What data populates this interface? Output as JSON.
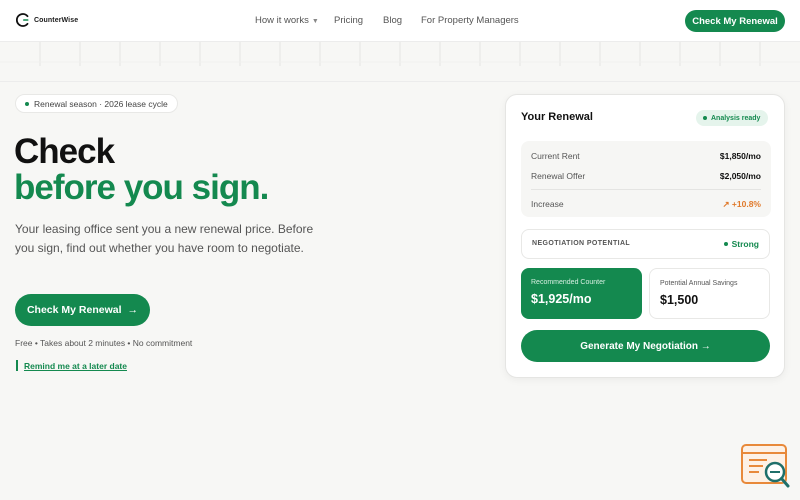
{
  "brand": {
    "name": "CounterWise"
  },
  "nav": {
    "items": [
      {
        "label": "How it works",
        "has_dropdown": true
      },
      {
        "label": "Pricing"
      },
      {
        "label": "Blog"
      },
      {
        "label": "For Property Managers"
      }
    ],
    "cta_label": "Check My Renewal"
  },
  "hero": {
    "pill_text": "Renewal season · 2026 lease cycle",
    "headline_line1": "Check",
    "headline_line2": "before you sign.",
    "subtext": "Your leasing office sent you a new renewal price. Before you sign, find out whether you have room to negotiate.",
    "cta_label": "Check My Renewal",
    "cta_arrow": "→",
    "meta": "Free • Takes about 2 minutes • No commitment",
    "remind_link": "Remind me at a later date"
  },
  "card": {
    "title": "Your Renewal",
    "badge": "Analysis ready",
    "rows": [
      {
        "label": "Current Rent",
        "value": "$1,850/mo"
      },
      {
        "label": "Renewal Offer",
        "value": "$2,050/mo"
      },
      {
        "label": "Increase",
        "value": "↗ +10.8%"
      }
    ],
    "potential_label": "NEGOTIATION POTENTIAL",
    "potential_value": "Strong",
    "counter_label": "Recommended Counter",
    "counter_value": "$1,925/mo",
    "savings_label": "Potential Annual Savings",
    "savings_value": "$1,500",
    "button_label": "Generate My Negotiation →"
  },
  "colors": {
    "accent": "#14894f",
    "increase": "#e07a2c",
    "background": "#f7f7f5",
    "widget": "#e8893a"
  },
  "icons": {
    "logo": "counterwise-logo-icon",
    "arrow": "arrow-right-icon",
    "widget": "search-browser-icon"
  }
}
